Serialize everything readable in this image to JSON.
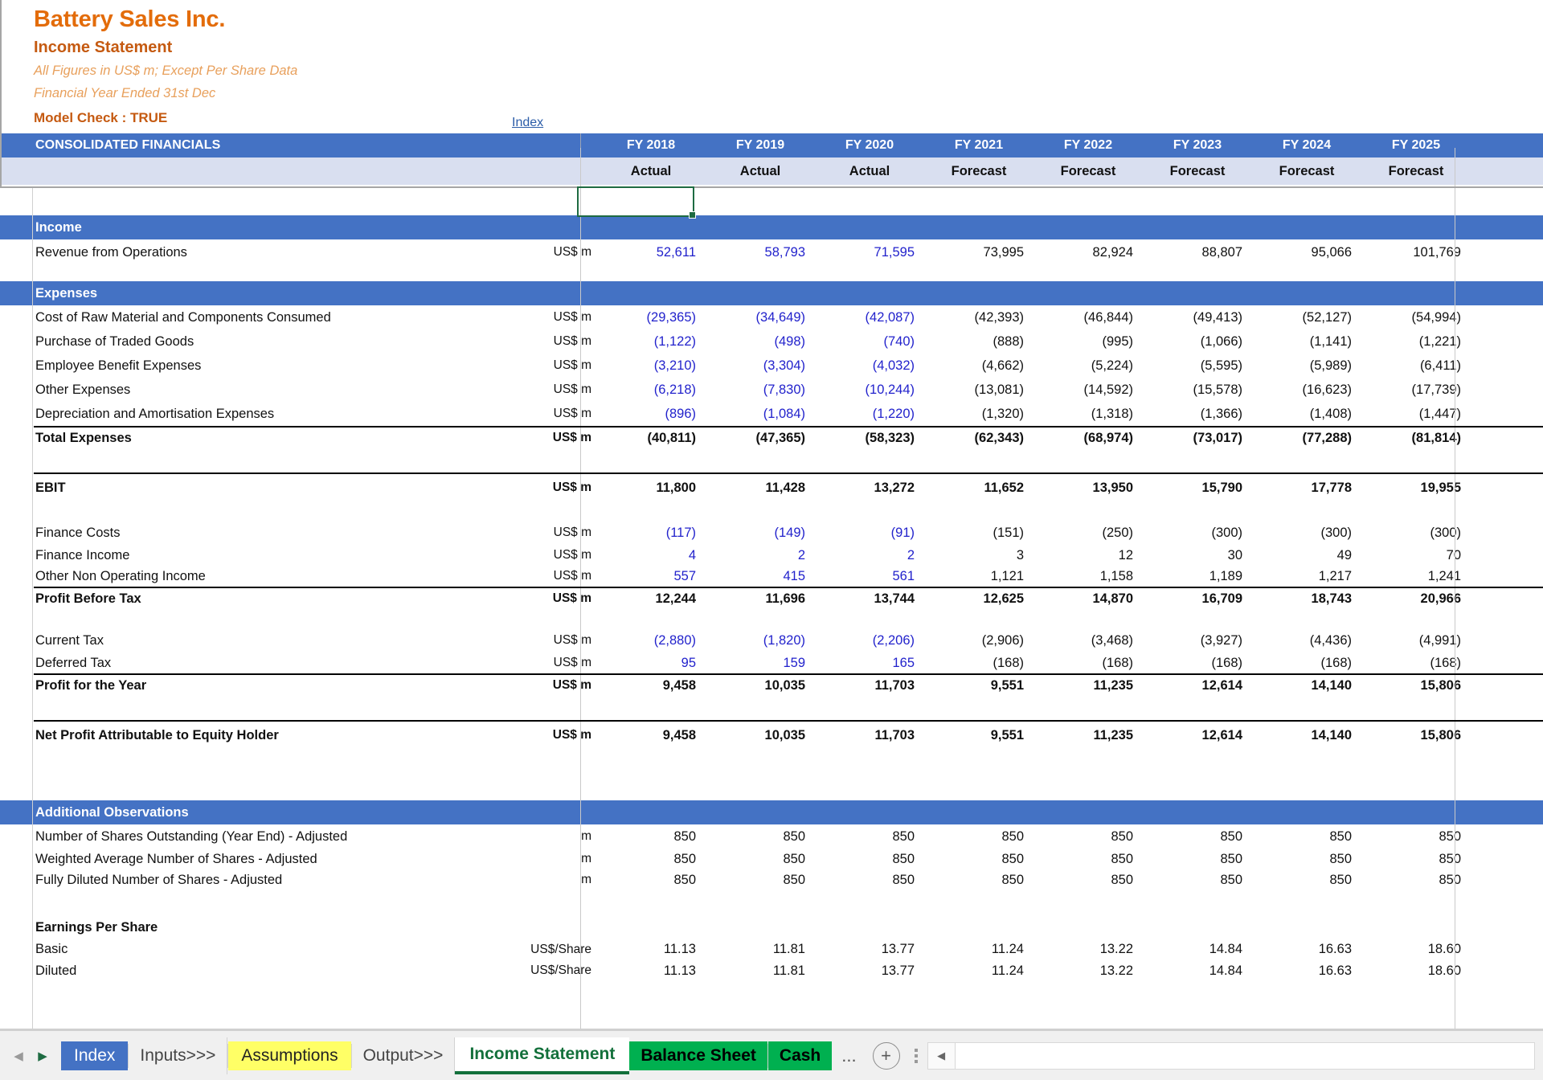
{
  "header": {
    "company": "Battery Sales Inc.",
    "statement": "Income Statement",
    "note1": "All Figures in US$ m; Except Per Share Data",
    "note2": "Financial Year Ended 31st Dec",
    "model_check": "Model Check : TRUE",
    "index_link": "Index",
    "table_title": "CONSOLIDATED FINANCIALS",
    "columns": [
      {
        "year": "FY 2018",
        "type": "Actual"
      },
      {
        "year": "FY 2019",
        "type": "Actual"
      },
      {
        "year": "FY 2020",
        "type": "Actual"
      },
      {
        "year": "FY 2021",
        "type": "Forecast"
      },
      {
        "year": "FY 2022",
        "type": "Forecast"
      },
      {
        "year": "FY 2023",
        "type": "Forecast"
      },
      {
        "year": "FY 2024",
        "type": "Forecast"
      },
      {
        "year": "FY 2025",
        "type": "Forecast"
      }
    ]
  },
  "colors": {
    "accent_orange": "#E36C0A",
    "band_blue": "#4472C4",
    "input_blue": "#2222CC",
    "formula_black": "#111111",
    "tab_green": "#00B050",
    "tab_yellow": "#FFFF66"
  },
  "sections": {
    "income_title": "Income",
    "expenses_title": "Expenses",
    "additional_title": "Additional Observations",
    "eps_title": "Earnings Per Share"
  },
  "rows": {
    "revenue": {
      "label": "Revenue from Operations",
      "unit": "US$ m",
      "values": [
        "52,611",
        "58,793",
        "71,595",
        "73,995",
        "82,924",
        "88,807",
        "95,066",
        "101,769"
      ]
    },
    "raw_material": {
      "label": "Cost of Raw Material and Components Consumed",
      "unit": "US$ m",
      "values": [
        "(29,365)",
        "(34,649)",
        "(42,087)",
        "(42,393)",
        "(46,844)",
        "(49,413)",
        "(52,127)",
        "(54,994)"
      ]
    },
    "traded_goods": {
      "label": "Purchase of Traded Goods",
      "unit": "US$ m",
      "values": [
        "(1,122)",
        "(498)",
        "(740)",
        "(888)",
        "(995)",
        "(1,066)",
        "(1,141)",
        "(1,221)"
      ]
    },
    "employee": {
      "label": "Employee Benefit Expenses",
      "unit": "US$ m",
      "values": [
        "(3,210)",
        "(3,304)",
        "(4,032)",
        "(4,662)",
        "(5,224)",
        "(5,595)",
        "(5,989)",
        "(6,411)"
      ]
    },
    "other_exp": {
      "label": "Other Expenses",
      "unit": "US$ m",
      "values": [
        "(6,218)",
        "(7,830)",
        "(10,244)",
        "(13,081)",
        "(14,592)",
        "(15,578)",
        "(16,623)",
        "(17,739)"
      ]
    },
    "depreciation": {
      "label": "Depreciation and Amortisation Expenses",
      "unit": "US$ m",
      "values": [
        "(896)",
        "(1,084)",
        "(1,220)",
        "(1,320)",
        "(1,318)",
        "(1,366)",
        "(1,408)",
        "(1,447)"
      ]
    },
    "total_exp": {
      "label": "Total Expenses",
      "unit": "US$ m",
      "values": [
        "(40,811)",
        "(47,365)",
        "(58,323)",
        "(62,343)",
        "(68,974)",
        "(73,017)",
        "(77,288)",
        "(81,814)"
      ]
    },
    "ebit": {
      "label": "EBIT",
      "unit": "US$ m",
      "values": [
        "11,800",
        "11,428",
        "13,272",
        "11,652",
        "13,950",
        "15,790",
        "17,778",
        "19,955"
      ]
    },
    "finance_costs": {
      "label": "Finance Costs",
      "unit": "US$ m",
      "values": [
        "(117)",
        "(149)",
        "(91)",
        "(151)",
        "(250)",
        "(300)",
        "(300)",
        "(300)"
      ]
    },
    "finance_income": {
      "label": "Finance Income",
      "unit": "US$ m",
      "values": [
        "4",
        "2",
        "2",
        "3",
        "12",
        "30",
        "49",
        "70"
      ]
    },
    "other_nonop": {
      "label": "Other Non Operating Income",
      "unit": "US$ m",
      "values": [
        "557",
        "415",
        "561",
        "1,121",
        "1,158",
        "1,189",
        "1,217",
        "1,241"
      ]
    },
    "pbt": {
      "label": "Profit Before Tax",
      "unit": "US$ m",
      "values": [
        "12,244",
        "11,696",
        "13,744",
        "12,625",
        "14,870",
        "16,709",
        "18,743",
        "20,966"
      ]
    },
    "current_tax": {
      "label": "Current Tax",
      "unit": "US$ m",
      "values": [
        "(2,880)",
        "(1,820)",
        "(2,206)",
        "(2,906)",
        "(3,468)",
        "(3,927)",
        "(4,436)",
        "(4,991)"
      ]
    },
    "deferred_tax": {
      "label": "Deferred Tax",
      "unit": "US$ m",
      "values": [
        "95",
        "159",
        "165",
        "(168)",
        "(168)",
        "(168)",
        "(168)",
        "(168)"
      ]
    },
    "profit_year": {
      "label": "Profit for the Year",
      "unit": "US$ m",
      "values": [
        "9,458",
        "10,035",
        "11,703",
        "9,551",
        "11,235",
        "12,614",
        "14,140",
        "15,806"
      ]
    },
    "net_profit": {
      "label": "Net Profit Attributable to Equity Holder",
      "unit": "US$ m",
      "values": [
        "9,458",
        "10,035",
        "11,703",
        "9,551",
        "11,235",
        "12,614",
        "14,140",
        "15,806"
      ]
    },
    "shares_out": {
      "label": "Number of Shares Outstanding (Year End) - Adjusted",
      "unit": "m",
      "values": [
        "850",
        "850",
        "850",
        "850",
        "850",
        "850",
        "850",
        "850"
      ]
    },
    "shares_wavg": {
      "label": "Weighted Average Number of Shares - Adjusted",
      "unit": "m",
      "values": [
        "850",
        "850",
        "850",
        "850",
        "850",
        "850",
        "850",
        "850"
      ]
    },
    "shares_dil": {
      "label": "Fully Diluted Number of Shares - Adjusted",
      "unit": "m",
      "values": [
        "850",
        "850",
        "850",
        "850",
        "850",
        "850",
        "850",
        "850"
      ]
    },
    "eps_basic": {
      "label": "Basic",
      "unit": "US$/Share",
      "values": [
        "11.13",
        "11.81",
        "13.77",
        "11.24",
        "13.22",
        "14.84",
        "16.63",
        "18.60"
      ]
    },
    "eps_diluted": {
      "label": "Diluted",
      "unit": "US$/Share",
      "values": [
        "11.13",
        "11.81",
        "13.77",
        "11.24",
        "13.22",
        "14.84",
        "16.63",
        "18.60"
      ]
    }
  },
  "sheet_tabs": [
    {
      "name": "Index",
      "style": "index"
    },
    {
      "name": "Inputs>>>",
      "style": "plain"
    },
    {
      "name": "Assumptions",
      "style": "yellow"
    },
    {
      "name": "Output>>>",
      "style": "plain"
    },
    {
      "name": "Income Statement",
      "style": "active"
    },
    {
      "name": "Balance Sheet",
      "style": "green"
    },
    {
      "name": "Cash",
      "style": "green"
    }
  ],
  "tabbar": {
    "ellipsis": "...",
    "add_sheet": "+",
    "nav_first": "◀",
    "nav_next": "▶",
    "scroll_left": "◀"
  }
}
